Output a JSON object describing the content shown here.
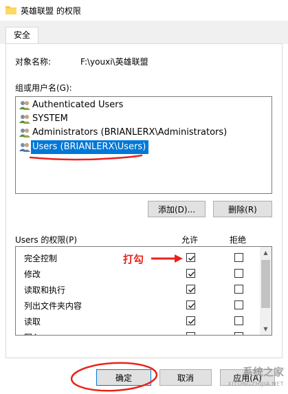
{
  "window": {
    "title": "英雄联盟 的权限"
  },
  "tabs": [
    {
      "label": "安全"
    }
  ],
  "object": {
    "label": "对象名称:",
    "value": "F:\\youxi\\英雄联盟"
  },
  "group_label": "组或用户名(G):",
  "users": [
    {
      "name": "Authenticated Users",
      "selected": false
    },
    {
      "name": "SYSTEM",
      "selected": false
    },
    {
      "name": "Administrators (BRIANLERX\\Administrators)",
      "selected": false
    },
    {
      "name": "Users (BRIANLERX\\Users)",
      "selected": true
    }
  ],
  "buttons": {
    "add": "添加(D)...",
    "remove": "删除(R)",
    "ok": "确定",
    "cancel": "取消",
    "apply": "应用(A)"
  },
  "permissions": {
    "header": "Users 的权限(P)",
    "allow_label": "允许",
    "deny_label": "拒绝",
    "rows": [
      {
        "name": "完全控制",
        "allow": true,
        "deny": false
      },
      {
        "name": "修改",
        "allow": true,
        "deny": false
      },
      {
        "name": "读取和执行",
        "allow": true,
        "deny": false
      },
      {
        "name": "列出文件夹内容",
        "allow": true,
        "deny": false
      },
      {
        "name": "读取",
        "allow": true,
        "deny": false
      },
      {
        "name": "写入",
        "allow": true,
        "deny": false
      }
    ]
  },
  "annotation": {
    "text": "打勾",
    "color": "#e8231b"
  },
  "watermark": {
    "text": "系统之家",
    "url": "XITONGZHIJIA.NET"
  },
  "colors": {
    "selection": "#0078d7",
    "annotation": "#e8231b"
  }
}
